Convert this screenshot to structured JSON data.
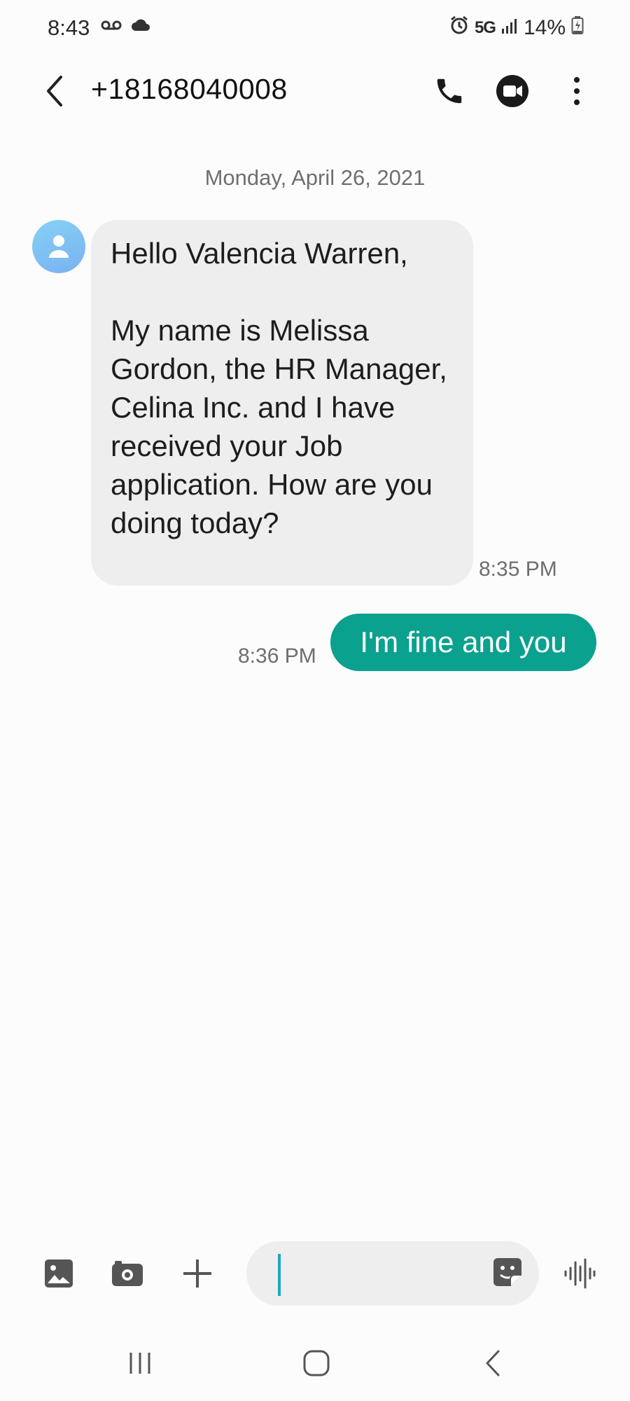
{
  "status_bar": {
    "time": "8:43",
    "network": "5G",
    "battery": "14%"
  },
  "header": {
    "title": "+18168040008",
    "icons": [
      "back-arrow-icon",
      "phone-icon",
      "video-call-icon",
      "more-vert-icon"
    ]
  },
  "conversation": {
    "date_separator": "Monday, April 26, 2021",
    "messages": [
      {
        "direction": "incoming",
        "text": "Hello Valencia Warren,\n\nMy name is Melissa Gordon, the HR Manager, Celina Inc. and I have received your Job application. How are you doing today?",
        "time": "8:35 PM"
      },
      {
        "direction": "outgoing",
        "text": "I'm fine and you",
        "time": "8:36 PM"
      }
    ]
  },
  "composer": {
    "value": "",
    "icons": [
      "gallery-icon",
      "camera-icon",
      "plus-icon",
      "sticker-icon",
      "voice-icon"
    ]
  },
  "nav_bar": {
    "icons": [
      "recents-icon",
      "home-icon",
      "back-icon"
    ]
  },
  "colors": {
    "outgoing_bubble": "#0aa18e",
    "incoming_bubble": "#eeeeee",
    "caret": "#1ea6c8",
    "background": "#fcfcfc"
  }
}
